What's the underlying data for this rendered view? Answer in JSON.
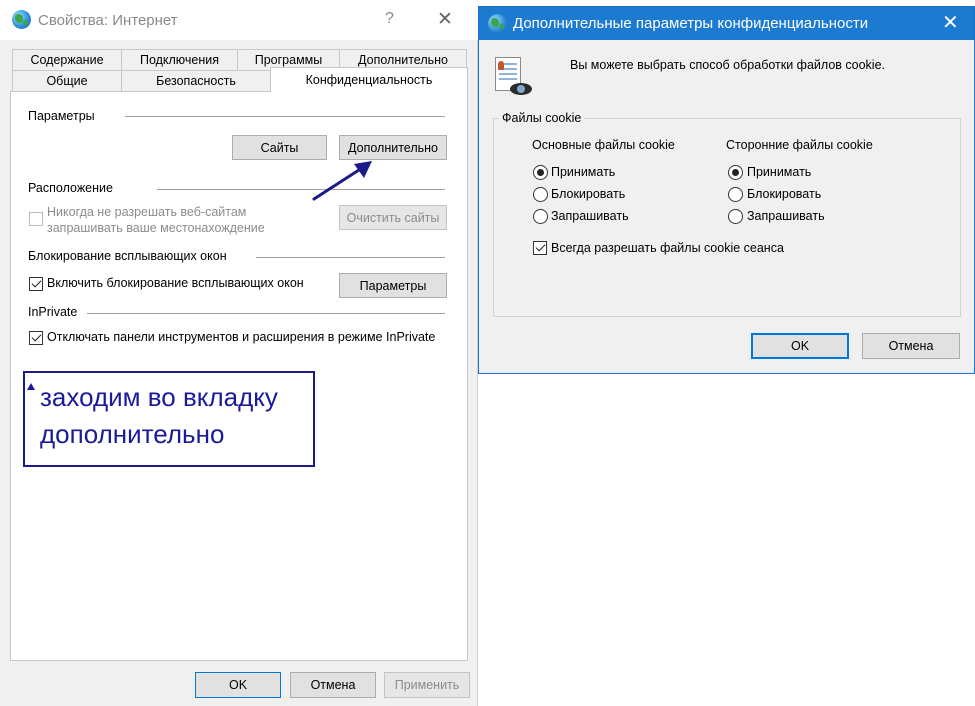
{
  "left_window": {
    "title": "Свойства: Интернет",
    "help_glyph": "?",
    "close_glyph": "✕",
    "tabs_row_back": [
      "Содержание",
      "Подключения",
      "Программы",
      "Дополнительно"
    ],
    "tabs_row_front": [
      "Общие",
      "Безопасность",
      "Конфиденциальность"
    ],
    "active_tab": "Конфиденциальность",
    "parameters_section": {
      "label": "Параметры",
      "sites_button": "Сайты",
      "advanced_button": "Дополнительно"
    },
    "location_section": {
      "label": "Расположение",
      "checkbox_line1": "Никогда не разрешать веб-сайтам",
      "checkbox_line2": "запрашивать ваше местонахождение",
      "checkbox_checked": false,
      "checkbox_disabled": true,
      "clear_sites_button": "Очистить сайты"
    },
    "popup_section": {
      "label": "Блокирование всплывающих окон",
      "checkbox_label": "Включить блокирование всплывающих окон",
      "checkbox_checked": true,
      "params_button": "Параметры"
    },
    "inprivate_section": {
      "label": "InPrivate",
      "checkbox_label": "Отключать панели инструментов и расширения в режиме InPrivate",
      "checkbox_checked": true
    },
    "annotation": {
      "text": "заходим во вкладку\n дополнительно",
      "color": "#1a1a9a"
    },
    "footer": {
      "ok": "OK",
      "cancel": "Отмена",
      "apply": "Применить"
    }
  },
  "right_window": {
    "title": "Дополнительные параметры конфиденциальности",
    "close_glyph": "✕",
    "accent_color": "#1c7ad1",
    "description": "Вы можете выбрать способ обработки файлов cookie.",
    "group_label": "Файлы cookie",
    "first_party": {
      "heading": "Основные файлы cookie",
      "options": [
        "Принимать",
        "Блокировать",
        "Запрашивать"
      ],
      "selected": "Принимать"
    },
    "third_party": {
      "heading": "Сторонние файлы cookie",
      "options": [
        "Принимать",
        "Блокировать",
        "Запрашивать"
      ],
      "selected": "Принимать"
    },
    "session_checkbox": {
      "label": "Всегда разрешать файлы cookie сеанса",
      "checked": true
    },
    "ok": "OK",
    "cancel": "Отмена"
  }
}
